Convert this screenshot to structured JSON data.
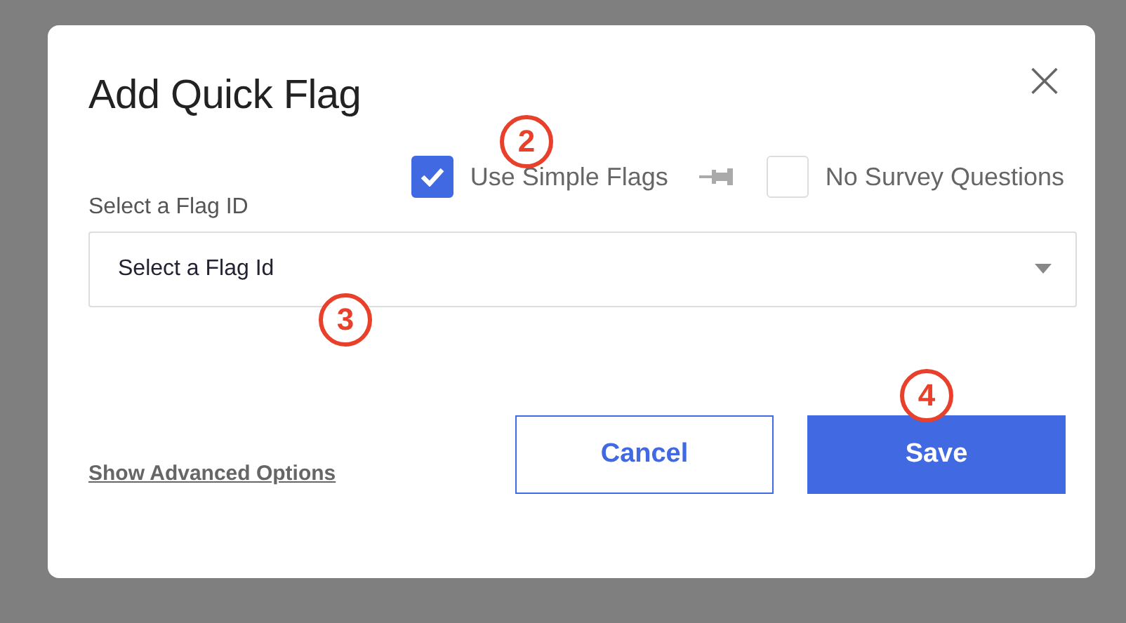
{
  "dialog": {
    "title": "Add Quick Flag",
    "close": "×"
  },
  "options": [
    {
      "label": "Use Simple Flags",
      "checked": true
    },
    {
      "label": "No Survey Questions",
      "checked": false
    }
  ],
  "select": {
    "label": "Select a Flag ID",
    "placeholder": "Select a Flag Id"
  },
  "link": "Show Advanced Options",
  "buttons": [
    {
      "label": "Cancel",
      "kind": "secondary"
    },
    {
      "label": "Save",
      "kind": "primary"
    }
  ],
  "annotations": [
    "2",
    "3",
    "4"
  ]
}
